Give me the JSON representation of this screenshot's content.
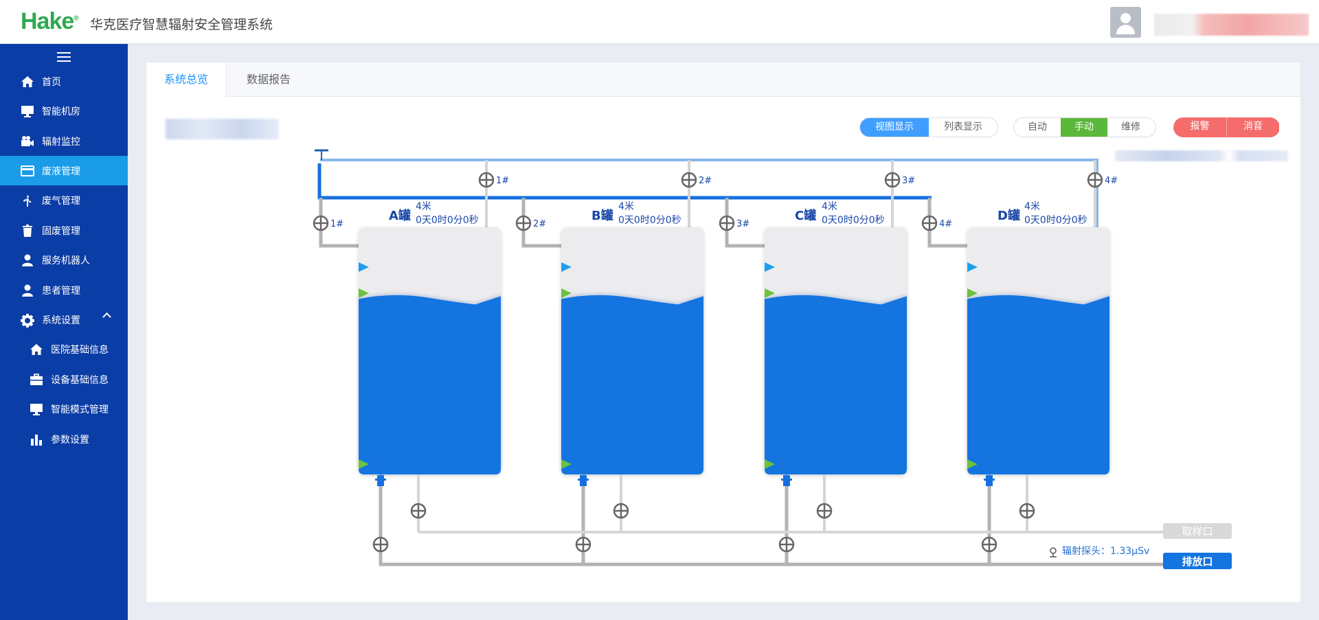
{
  "header": {
    "logo": "Hake",
    "logo_mark": "®",
    "title": "华克医疗智慧辐射安全管理系统"
  },
  "sidebar": {
    "items": [
      {
        "label": "首页",
        "icon": "home-icon"
      },
      {
        "label": "智能机房",
        "icon": "monitor-icon"
      },
      {
        "label": "辐射监控",
        "icon": "camera-icon"
      },
      {
        "label": "废液管理",
        "icon": "card-icon",
        "active": true
      },
      {
        "label": "废气管理",
        "icon": "fan-icon"
      },
      {
        "label": "固废管理",
        "icon": "trash-icon"
      },
      {
        "label": "服务机器人",
        "icon": "user-icon"
      },
      {
        "label": "患者管理",
        "icon": "user-icon"
      },
      {
        "label": "系统设置",
        "icon": "gear-icon",
        "expanded": true
      }
    ],
    "sub_items": [
      {
        "label": "医院基础信息",
        "icon": "home-icon"
      },
      {
        "label": "设备基础信息",
        "icon": "briefcase-icon"
      },
      {
        "label": "智能模式管理",
        "icon": "monitor-icon"
      },
      {
        "label": "参数设置",
        "icon": "bar-chart-icon"
      }
    ]
  },
  "tabs": [
    {
      "label": "系统总览",
      "active": true
    },
    {
      "label": "数据报告",
      "active": false
    }
  ],
  "view_toggle": [
    "视图显示",
    "列表显示"
  ],
  "view_active": 0,
  "mode_toggle": [
    "自动",
    "手动",
    "维修"
  ],
  "mode_active": 1,
  "alarm_buttons": [
    "报警",
    "消音"
  ],
  "tanks": [
    {
      "name": "A罐",
      "level": "4米",
      "time": "0天0时0分0秒",
      "inlet": "1#",
      "valve": "1#",
      "fill": 0.71
    },
    {
      "name": "B罐",
      "level": "4米",
      "time": "0天0时0分0秒",
      "inlet": "2#",
      "valve": "2#",
      "fill": 0.71
    },
    {
      "name": "C罐",
      "level": "4米",
      "time": "0天0时0分0秒",
      "inlet": "3#",
      "valve": "3#",
      "fill": 0.71
    },
    {
      "name": "D罐",
      "level": "4米",
      "time": "0天0时0分0秒",
      "inlet": "4#",
      "valve": "4#",
      "fill": 0.71
    }
  ],
  "outlets": {
    "sample": "取样口",
    "discharge": "排放口"
  },
  "probe": "辐射探头：1.33μSv",
  "colors": {
    "sidebar": "#0b3da6",
    "active_nav": "#1b9ce8",
    "water": "#1474e0",
    "pipe_gray": "#b3b3b3",
    "pipe_blue": "#1470e0",
    "pipe_light": "#8ab8ea",
    "manual_green": "#5cb83a",
    "alarm_red": "#f56c6c"
  }
}
